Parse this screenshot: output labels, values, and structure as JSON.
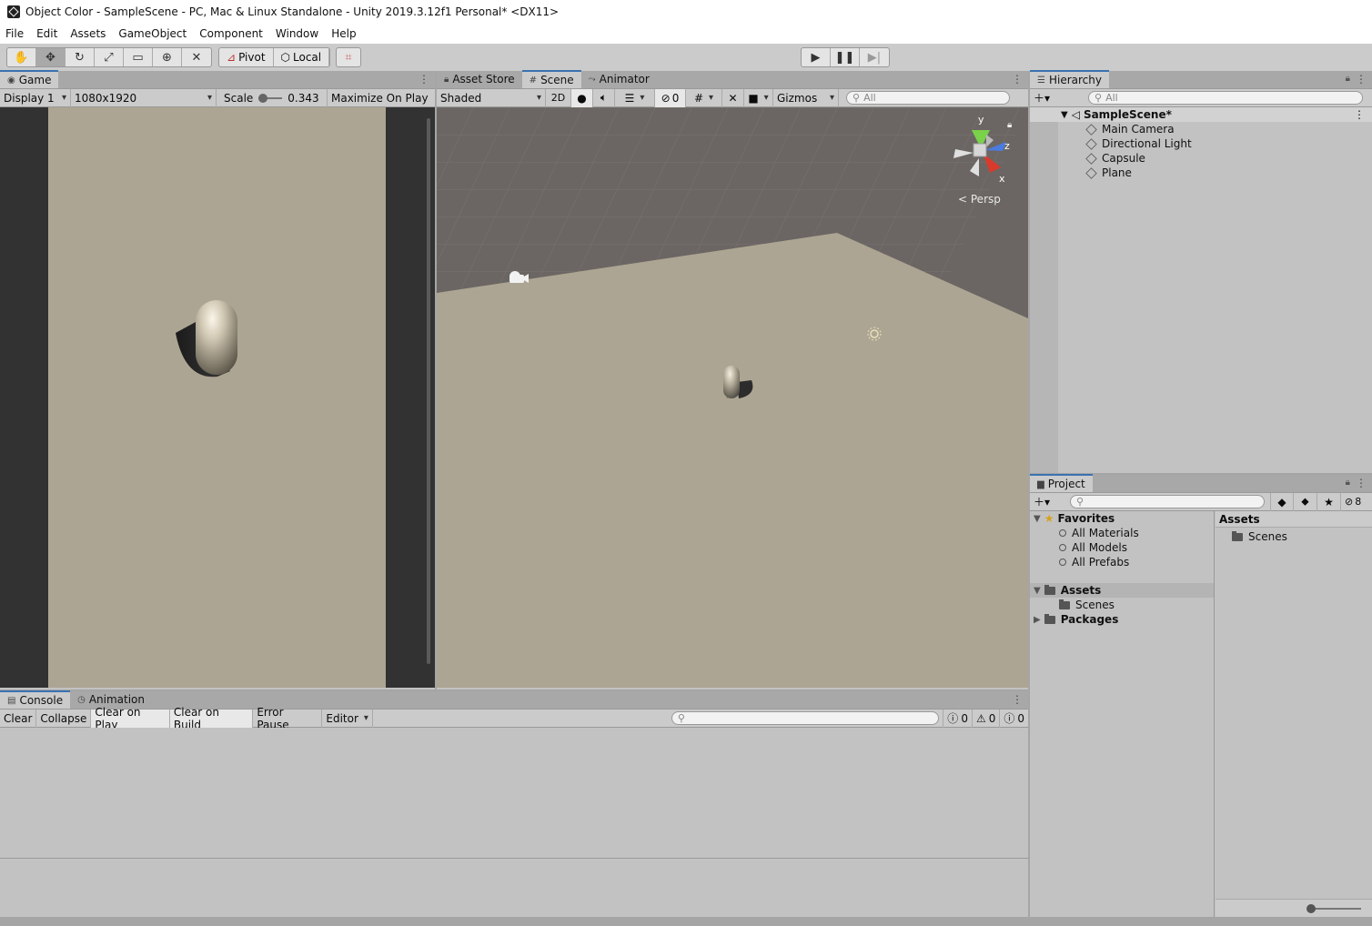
{
  "window": {
    "title": "Object Color - SampleScene - PC, Mac & Linux Standalone - Unity 2019.3.12f1 Personal* <DX11>"
  },
  "menu": [
    "File",
    "Edit",
    "Assets",
    "GameObject",
    "Component",
    "Window",
    "Help"
  ],
  "toolbar": {
    "tools": [
      "hand-icon",
      "move-icon",
      "rotate-icon",
      "scale-icon",
      "rect-tool-icon",
      "transform-icon",
      "custom-tool-icon"
    ],
    "pivot_label": "Pivot",
    "local_label": "Local",
    "active_tool": "move-icon"
  },
  "game": {
    "tab_label": "Game",
    "display": "Display 1",
    "resolution": "1080x1920",
    "scale_label": "Scale",
    "scale_value": "0.343",
    "maximize_label": "Maximize On Play"
  },
  "scene": {
    "tabs": [
      "Asset Store",
      "Scene",
      "Animator"
    ],
    "active_tab": "Scene",
    "shading": "Shaded",
    "mode_2d": "2D",
    "hidden_count": "0",
    "gizmos_label": "Gizmos",
    "search_placeholder": "All",
    "persp_label": "Persp",
    "axes": {
      "y": "y",
      "z": "z",
      "x": "x"
    }
  },
  "hierarchy": {
    "tab_label": "Hierarchy",
    "search_placeholder": "All",
    "scene_name": "SampleScene*",
    "objects": [
      "Main Camera",
      "Directional Light",
      "Capsule",
      "Plane"
    ]
  },
  "project": {
    "tab_label": "Project",
    "hidden_count": "8",
    "favorites_label": "Favorites",
    "favorites": [
      "All Materials",
      "All Models",
      "All Prefabs"
    ],
    "assets_label": "Assets",
    "assets_children": [
      "Scenes"
    ],
    "packages_label": "Packages",
    "content_header": "Assets",
    "content_items": [
      "Scenes"
    ]
  },
  "console": {
    "tabs": [
      "Console",
      "Animation"
    ],
    "buttons": [
      "Clear",
      "Collapse",
      "Clear on Play",
      "Clear on Build",
      "Error Pause",
      "Editor"
    ],
    "log_count": "0",
    "warn_count": "0",
    "error_count": "0"
  },
  "colors": {
    "accent": "#3a72b0",
    "ground": "#ada593",
    "grid_bg": "#6b6663"
  }
}
